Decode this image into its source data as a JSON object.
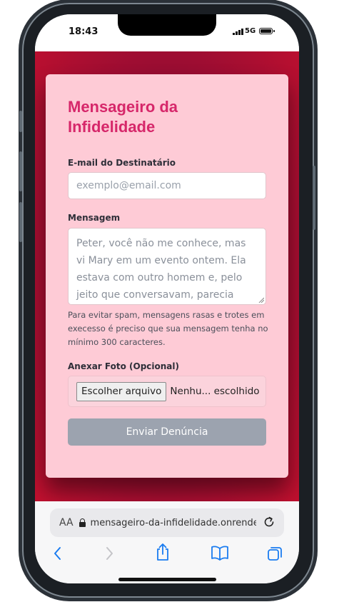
{
  "status": {
    "time": "18:43",
    "network": "5G"
  },
  "form": {
    "title": "Mensageiro da Infidelidade",
    "email_label": "E-mail do Destinatário",
    "email_placeholder": "exemplo@email.com",
    "message_label": "Mensagem",
    "message_text": "Peter, você não me conhece, mas vi Mary em um evento ontem. Ela estava com outro homem e, pelo jeito que conversavam, parecia algo mais...",
    "hint": "Para evitar spam, mensagens rasas e trotes em execesso é preciso que sua mensagem tenha no mínimo 300 caracteres.",
    "photo_label": "Anexar Foto (Opcional)",
    "file_button": "Escolher arquivo",
    "file_status": "Nenhu... escolhido",
    "submit": "Enviar Denúncia"
  },
  "browser": {
    "aa": "AA",
    "url": "mensageiro-da-infidelidade.onrender.com"
  },
  "colors": {
    "title": "#d6276a",
    "card": "#fecbd6",
    "background": "#a30d30",
    "submit": "#9ca3af",
    "ios_blue": "#1a7cf0"
  }
}
